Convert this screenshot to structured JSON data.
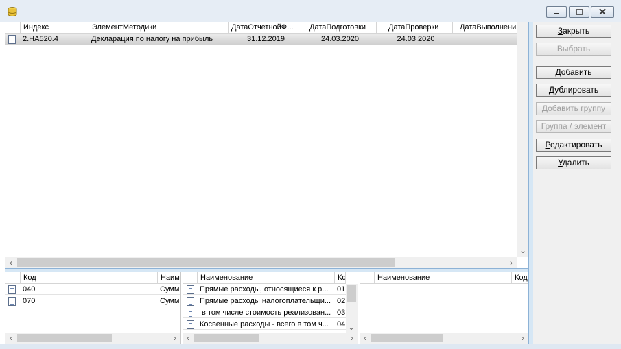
{
  "main_grid": {
    "columns": [
      "Индекс",
      "ЭлементМетодики",
      "ДатаОтчетнойФ...",
      "ДатаПодготовки",
      "ДатаПроверки",
      "ДатаВыполнени"
    ],
    "rows": [
      {
        "index": "2.НА520.4",
        "element": "Декларация по налогу на прибыль",
        "report_date": "31.12.2019",
        "prep_date": "24.03.2020",
        "check_date": "24.03.2020",
        "done_date": ""
      }
    ]
  },
  "pane_left": {
    "columns": [
      "Код",
      "Наиме"
    ],
    "rows": [
      {
        "code": "040",
        "name": "Сумма"
      },
      {
        "code": "070",
        "name": "Сумма"
      }
    ]
  },
  "pane_middle": {
    "columns": [
      "Наименование",
      "Ко"
    ],
    "rows": [
      {
        "name": "Прямые расходы, относящиеся к р...",
        "code": "01"
      },
      {
        "name": "Прямые расходы налогоплательщи...",
        "code": "02"
      },
      {
        "name": "в том числе стоимость реализован...",
        "code": "03"
      },
      {
        "name": "Косвенные расходы - всего в том ч...",
        "code": "04"
      }
    ]
  },
  "pane_right": {
    "columns": [
      "Наименование",
      "Код"
    ]
  },
  "buttons": {
    "close": {
      "label": "Закрыть",
      "underline": "З",
      "rest": "акрыть",
      "enabled": true
    },
    "select": {
      "label": "Выбрать",
      "enabled": false
    },
    "add": {
      "label": "Добавить",
      "underline": "Д",
      "rest": "обавить",
      "enabled": true
    },
    "duplicate": {
      "label": "Дублировать",
      "underline": "Д",
      "rest": "ублировать",
      "enabled": true
    },
    "add_group": {
      "label": "Добавить группу",
      "enabled": false
    },
    "group_element": {
      "label": "Группа / элемент",
      "enabled": false
    },
    "edit": {
      "label": "Редактировать",
      "underline": "Р",
      "rest": "едактировать",
      "enabled": true
    },
    "delete": {
      "label": "Удалить",
      "underline": "У",
      "rest": "далить",
      "enabled": true
    }
  },
  "icons": [
    "app-icon",
    "minimize-icon",
    "maximize-icon",
    "close-icon",
    "document-icon",
    "scroll-left-icon",
    "scroll-right-icon",
    "scroll-down-icon"
  ],
  "colors": {
    "titlebar": "#e6edf5",
    "splitter": "#d6e7f5",
    "selected_row": "#d4d4d4",
    "panel": "#f0f0f0"
  }
}
